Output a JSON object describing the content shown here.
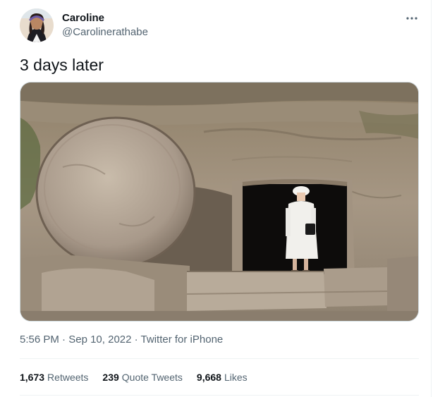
{
  "user": {
    "display_name": "Caroline",
    "handle": "@Carolinerathabe"
  },
  "tweet": {
    "text": "3 days later"
  },
  "meta": {
    "time": "5:56 PM",
    "date": "Sep 10, 2022",
    "client": "Twitter for iPhone",
    "separator": "·"
  },
  "stats": [
    {
      "count": "1,673",
      "label": "Retweets"
    },
    {
      "count": "239",
      "label": "Quote Tweets"
    },
    {
      "count": "9,668",
      "label": "Likes"
    }
  ],
  "colors": {
    "text_primary": "#0f1419",
    "text_secondary": "#536471",
    "divider": "#eff3f4"
  }
}
